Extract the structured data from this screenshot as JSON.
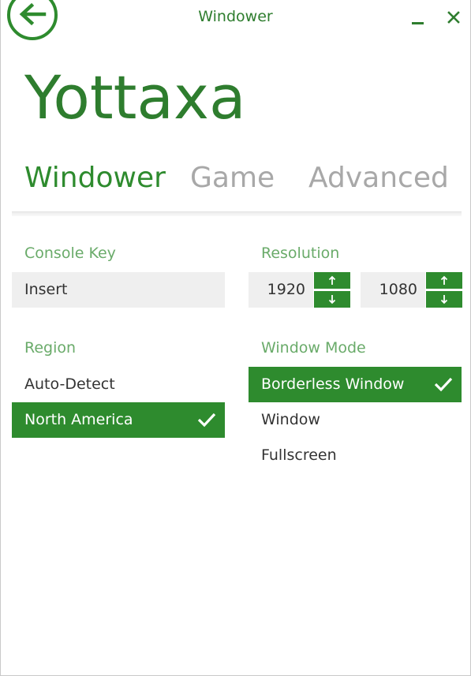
{
  "window": {
    "title": "Windower"
  },
  "profile": {
    "name": "Yottaxa"
  },
  "tabs": [
    {
      "label": "Windower",
      "active": true
    },
    {
      "label": "Game",
      "active": false
    },
    {
      "label": "Advanced",
      "active": false
    }
  ],
  "console_key": {
    "label": "Console Key",
    "value": "Insert"
  },
  "resolution": {
    "label": "Resolution",
    "width": "1920",
    "height": "1080"
  },
  "region": {
    "label": "Region",
    "options": [
      {
        "label": "Auto-Detect",
        "selected": false
      },
      {
        "label": "North America",
        "selected": true
      }
    ]
  },
  "window_mode": {
    "label": "Window Mode",
    "options": [
      {
        "label": "Borderless Window",
        "selected": true
      },
      {
        "label": "Window",
        "selected": false
      },
      {
        "label": "Fullscreen",
        "selected": false
      }
    ]
  },
  "colors": {
    "accent": "#2e8b2e",
    "label": "#6aab6a",
    "inactive_tab": "#a8a8a8",
    "field_bg": "#efefef"
  },
  "icons": {
    "back": "arrow-left-circle-icon",
    "minimize": "minimize-icon",
    "close": "close-icon",
    "up": "arrow-up-icon",
    "down": "arrow-down-icon",
    "check": "checkmark-icon"
  }
}
